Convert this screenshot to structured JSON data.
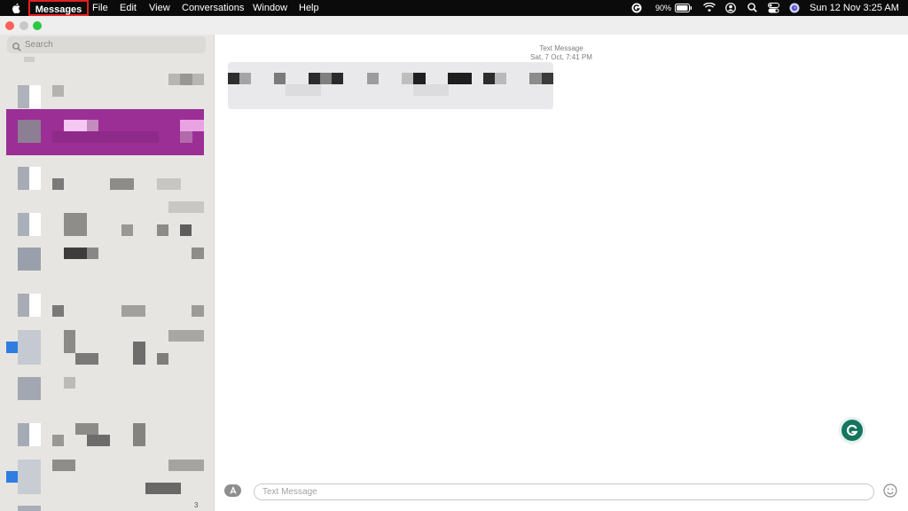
{
  "menubar": {
    "apple_icon": "apple-logo-icon",
    "app_name": "Messages",
    "items": [
      "File",
      "Edit",
      "View",
      "Conversations",
      "Window",
      "Help"
    ],
    "battery": "90%",
    "datetime": "Sun 12 Nov  3:25 AM",
    "status_icons": [
      "grammarly-icon",
      "battery-icon",
      "wifi-icon",
      "user-icon",
      "search-icon",
      "control-center-icon",
      "siri-icon"
    ]
  },
  "window": {
    "traffic_lights": {
      "close": "#ff5f57",
      "minimize": "#c8c8c8",
      "zoom": "#28c840"
    }
  },
  "sidebar": {
    "search_placeholder": "Search",
    "selected_color": "#9b2f95",
    "last_item_badge": "3"
  },
  "conversation": {
    "service_label": "Text Message",
    "timestamp": "Sat, 7 Oct, 7:41 PM",
    "composer_placeholder": "Text Message"
  }
}
